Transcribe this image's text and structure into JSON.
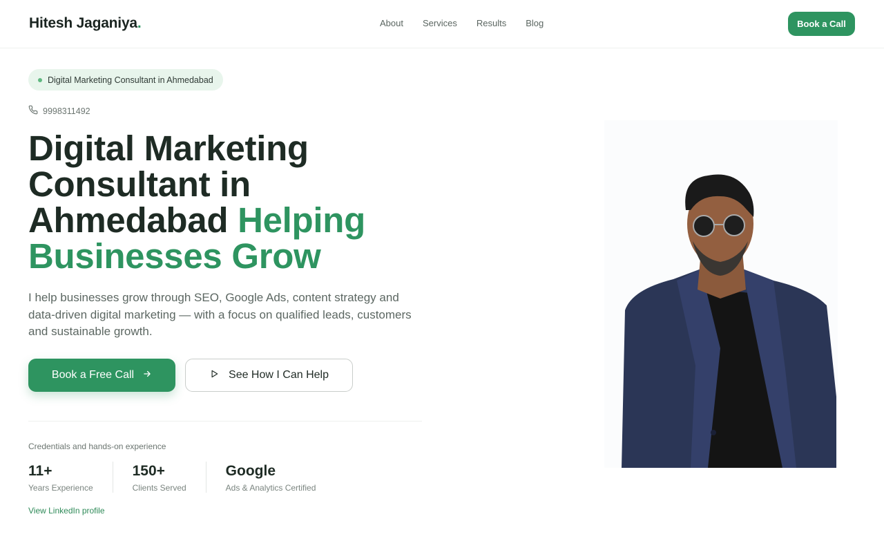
{
  "header": {
    "logo_text": "Hitesh Jaganiya",
    "logo_dot": ".",
    "nav": [
      {
        "label": "About"
      },
      {
        "label": "Services"
      },
      {
        "label": "Results"
      },
      {
        "label": "Blog"
      }
    ],
    "cta_label": "Book a Call"
  },
  "hero": {
    "badge": "Digital Marketing Consultant in Ahmedabad",
    "phone": "9998311492",
    "headline_dark": "Digital Marketing Consultant in Ahmedabad",
    "headline_green": "Helping Businesses Grow",
    "lead": "I help businesses grow through SEO, Google Ads, content strategy and data-driven digital marketing — with a focus on qualified leads, customers and sustainable growth.",
    "primary_button": "Book a Free Call",
    "secondary_button": "See How I Can Help",
    "credentials_title": "Credentials and hands-on experience",
    "stats": [
      {
        "value": "11+",
        "label": "Years Experience"
      },
      {
        "value": "150+",
        "label": "Clients Served"
      },
      {
        "value": "Google",
        "label": "Ads & Analytics Certified"
      }
    ],
    "linkedin_label": "View LinkedIn profile"
  },
  "colors": {
    "brand_green": "#2e9460",
    "badge_bg": "#e8f5ec",
    "heading": "#1e2b24"
  },
  "icons": [
    "phone-icon",
    "arrow-right-icon",
    "play-icon"
  ]
}
